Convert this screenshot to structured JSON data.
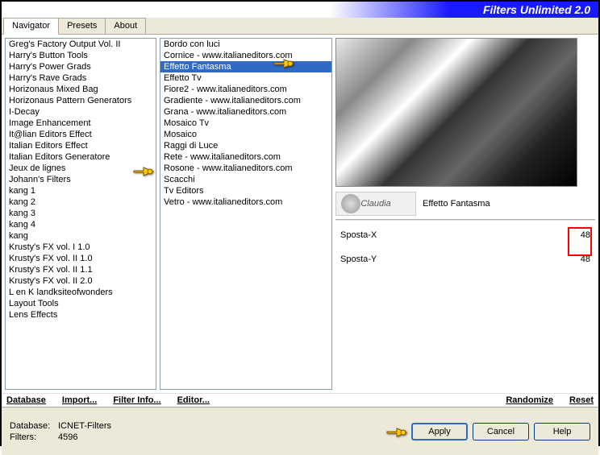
{
  "header": {
    "title": "Filters Unlimited 2.0"
  },
  "tabs": [
    {
      "label": "Navigator",
      "active": true
    },
    {
      "label": "Presets",
      "active": false
    },
    {
      "label": "About",
      "active": false
    }
  ],
  "categories": [
    "Greg's Factory Output Vol. II",
    "Harry's Button Tools",
    "Harry's Power Grads",
    "Harry's Rave Grads",
    "Horizonaus Mixed Bag",
    "Horizonaus Pattern Generators",
    "I-Decay",
    "Image Enhancement",
    "It@lian Editors Effect",
    "Italian Editors Effect",
    "Italian Editors Generatore",
    "Jeux de lignes",
    "Johann's Filters",
    "kang 1",
    "kang 2",
    "kang 3",
    "kang 4",
    "kang",
    "Krusty's FX vol. I 1.0",
    "Krusty's FX vol. II 1.0",
    "Krusty's FX vol. II 1.1",
    "Krusty's FX vol. II 2.0",
    "L en K landksiteofwonders",
    "Layout Tools",
    "Lens Effects"
  ],
  "selected_category_index": 8,
  "filters": [
    "Bordo con luci",
    "Cornice - www.italianeditors.com",
    "Effetto Fantasma",
    "Effetto Tv",
    "Fiore2 - www.italianeditors.com",
    "Gradiente - www.italianeditors.com",
    "Grana - www.italianeditors.com",
    "Mosaico Tv",
    "Mosaico",
    "Raggi di Luce",
    "Rete - www.italianeditors.com",
    "Rosone - www.italianeditors.com",
    "Scacchi",
    "Tv Editors",
    "Vetro - www.italianeditors.com"
  ],
  "selected_filter_index": 2,
  "brand": "Claudia",
  "current_filter": "Effetto Fantasma",
  "params": [
    {
      "label": "Sposta-X",
      "value": "48"
    },
    {
      "label": "Sposta-Y",
      "value": "48"
    }
  ],
  "buttons_left": [
    "Database",
    "Import...",
    "Filter Info...",
    "Editor..."
  ],
  "buttons_right": [
    "Randomize",
    "Reset"
  ],
  "bottom": {
    "db_label": "Database:",
    "db_value": "ICNET-Filters",
    "filters_label": "Filters:",
    "filters_value": "4596",
    "apply": "Apply",
    "cancel": "Cancel",
    "help": "Help"
  }
}
